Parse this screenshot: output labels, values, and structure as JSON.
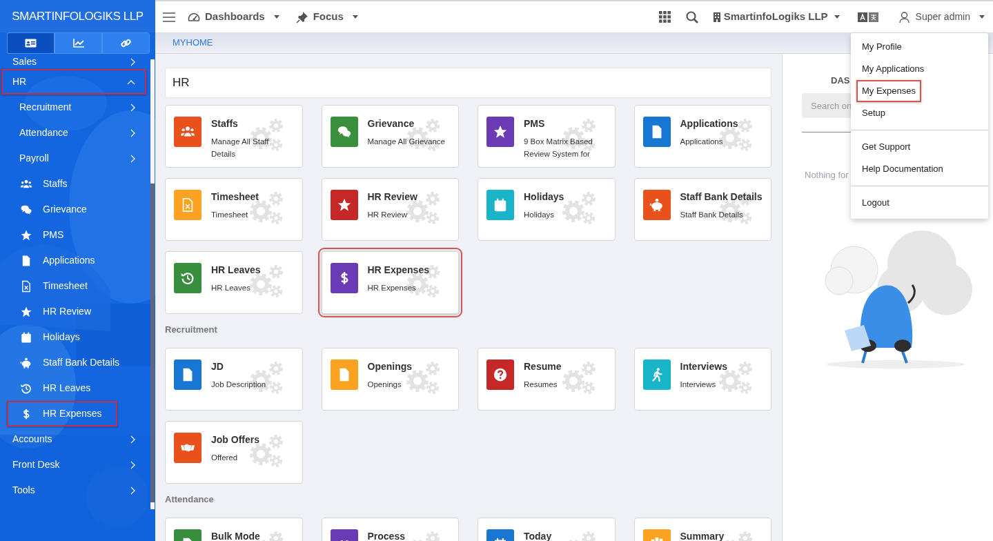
{
  "sidebar": {
    "brand": "SMARTINFOLOGIKS LLP",
    "tabs": [
      {
        "selected": true
      },
      {
        "selected": false
      },
      {
        "selected": false
      }
    ],
    "items": [
      {
        "label": "Sales",
        "kind": "menu",
        "expanded": false,
        "highlighted": false
      },
      {
        "label": "HR",
        "kind": "menu",
        "expanded": true,
        "highlighted": true,
        "children": [
          {
            "label": "Recruitment",
            "kind": "submenu",
            "expanded": false,
            "highlighted": false
          },
          {
            "label": "Attendance",
            "kind": "submenu",
            "expanded": false,
            "highlighted": false
          },
          {
            "label": "Payroll",
            "kind": "submenu",
            "expanded": false,
            "highlighted": false
          },
          {
            "label": "Staffs",
            "kind": "app",
            "highlighted": false
          },
          {
            "label": "Grievance",
            "kind": "app",
            "highlighted": false
          },
          {
            "label": "PMS",
            "kind": "app",
            "highlighted": false
          },
          {
            "label": "Applications",
            "kind": "app",
            "highlighted": false
          },
          {
            "label": "Timesheet",
            "kind": "app",
            "highlighted": false
          },
          {
            "label": "HR Review",
            "kind": "app",
            "highlighted": false
          },
          {
            "label": "Holidays",
            "kind": "app",
            "highlighted": false
          },
          {
            "label": "Staff Bank Details",
            "kind": "app",
            "highlighted": false
          },
          {
            "label": "HR Leaves",
            "kind": "app",
            "highlighted": false
          },
          {
            "label": "HR Expenses",
            "kind": "app",
            "highlighted": true
          }
        ]
      },
      {
        "label": "Accounts",
        "kind": "menu",
        "expanded": false,
        "highlighted": false
      },
      {
        "label": "Front Desk",
        "kind": "menu",
        "expanded": false,
        "highlighted": false
      },
      {
        "label": "Tools",
        "kind": "menu",
        "expanded": false,
        "highlighted": false
      }
    ]
  },
  "topbar": {
    "menus": [
      {
        "label": "Dashboards"
      },
      {
        "label": "Focus"
      }
    ],
    "company": "SmartinfoLogiks LLP",
    "user": "Super admin"
  },
  "breadcrumb": "MYHOME",
  "search": {
    "value": "HR"
  },
  "sections": [
    {
      "cards": [
        {
          "title": "Staffs",
          "subtitle": "Manage All Staff Details",
          "color": "#e8501c",
          "highlighted": false
        },
        {
          "title": "Grievance",
          "subtitle": "Manage All Grievance",
          "color": "#3a8f3c",
          "highlighted": false
        },
        {
          "title": "PMS",
          "subtitle": "9 Box Matrix Based Review System for",
          "color": "#6a3bb5",
          "highlighted": false
        },
        {
          "title": "Applications",
          "subtitle": "Applications",
          "color": "#1976d2",
          "highlighted": false
        },
        {
          "title": "Timesheet",
          "subtitle": "Timesheet",
          "color": "#fba321",
          "highlighted": false
        },
        {
          "title": "HR Review",
          "subtitle": "HR Review",
          "color": "#c62828",
          "highlighted": false
        },
        {
          "title": "Holidays",
          "subtitle": "Holidays",
          "color": "#19b4c8",
          "highlighted": false
        },
        {
          "title": "Staff Bank Details",
          "subtitle": "Staff Bank Details",
          "color": "#e8501c",
          "highlighted": false
        },
        {
          "title": "HR Leaves",
          "subtitle": "HR Leaves",
          "color": "#388e3c",
          "highlighted": false
        },
        {
          "title": "HR Expenses",
          "subtitle": "HR Expenses",
          "color": "#6a3bb5",
          "highlighted": true
        }
      ]
    },
    {
      "heading": "Recruitment",
      "cards": [
        {
          "title": "JD",
          "subtitle": "Job Description",
          "color": "#1976d2",
          "highlighted": false
        },
        {
          "title": "Openings",
          "subtitle": "Openings",
          "color": "#fba321",
          "highlighted": false
        },
        {
          "title": "Resume",
          "subtitle": "Resumes",
          "color": "#c62828",
          "highlighted": false
        },
        {
          "title": "Interviews",
          "subtitle": "Interviews",
          "color": "#19b4c8",
          "highlighted": false
        },
        {
          "title": "Job Offers",
          "subtitle": "Offered",
          "color": "#e8501c",
          "highlighted": false
        }
      ]
    },
    {
      "heading": "Attendance",
      "cards": [
        {
          "title": "Bulk Mode",
          "color": "#388e3c",
          "highlighted": false
        },
        {
          "title": "Process",
          "color": "#6a3bb5",
          "highlighted": false
        },
        {
          "title": "Today",
          "color": "#1976d2",
          "highlighted": false
        },
        {
          "title": "Summary",
          "color": "#fba321",
          "highlighted": false
        }
      ]
    }
  ],
  "right_panel": {
    "heading": "DAS",
    "search_placeholder": "Search on",
    "empty_text": "Nothing for"
  },
  "user_menu": {
    "groups": [
      {
        "items": [
          {
            "label": "My Profile",
            "highlighted": false
          },
          {
            "label": "My Applications",
            "highlighted": false
          },
          {
            "label": "My Expenses",
            "highlighted": true
          },
          {
            "label": "Setup",
            "highlighted": false
          }
        ]
      },
      {
        "items": [
          {
            "label": "Get Support",
            "highlighted": false
          },
          {
            "label": "Help Documentation",
            "highlighted": false
          }
        ]
      },
      {
        "items": [
          {
            "label": "Logout",
            "highlighted": false
          }
        ]
      }
    ]
  }
}
